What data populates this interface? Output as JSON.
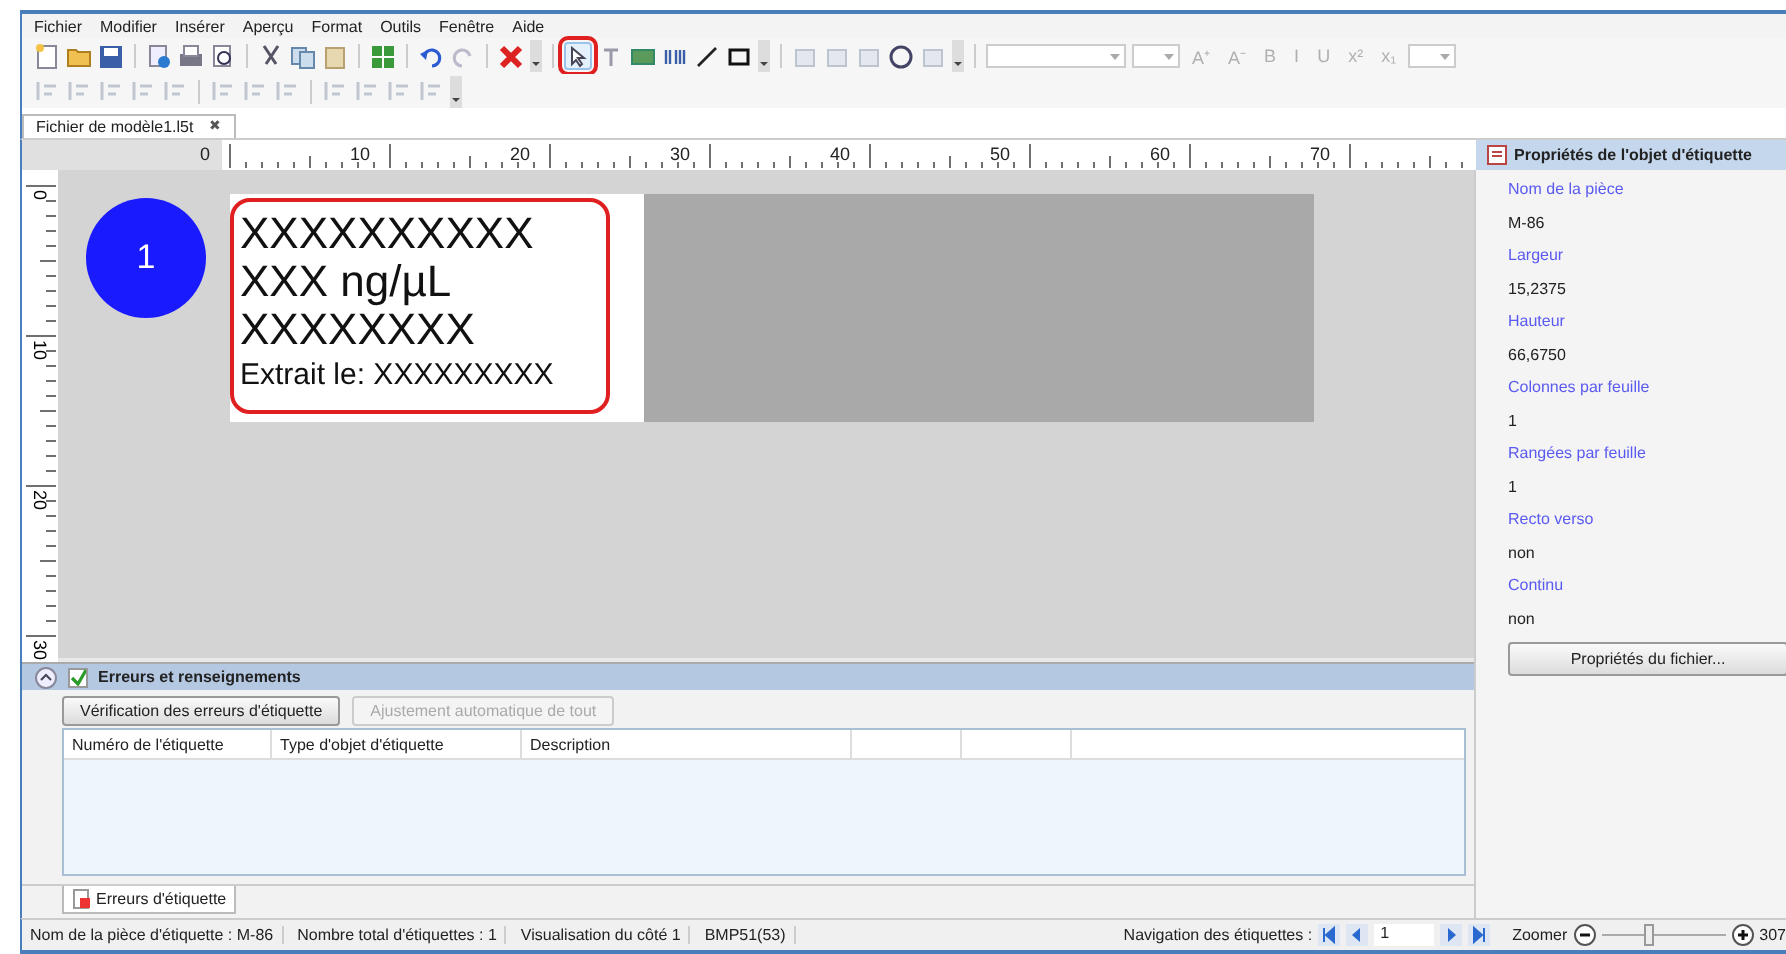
{
  "menu": [
    "Fichier",
    "Modifier",
    "Insérer",
    "Aperçu",
    "Format",
    "Outils",
    "Fenêtre",
    "Aide"
  ],
  "toolbar": {
    "pointer_highlighted": true,
    "format_buttons": [
      "A⁺",
      "A⁻",
      "B",
      "I",
      "U",
      "x²",
      "x₁"
    ]
  },
  "document_tab": {
    "label": "Fichier de modèle1.l5t",
    "close": "✖"
  },
  "ruler": {
    "horizontal": [
      "0",
      "10",
      "20",
      "30",
      "40",
      "50",
      "60",
      "70"
    ],
    "vertical": [
      "0",
      "10",
      "20",
      "30"
    ]
  },
  "label": {
    "number": "1",
    "highlighted": true,
    "lines": [
      {
        "text": "XXXXXXXXXX",
        "kind": "large"
      },
      {
        "text": "XXX ng/µL",
        "kind": "large"
      },
      {
        "text": "XXXXXXXX",
        "kind": "large"
      },
      {
        "text": "Extrait le: XXXXXXXXX",
        "kind": "small"
      }
    ]
  },
  "errors_panel": {
    "title": "Erreurs et renseignements",
    "checked": true,
    "buttons": [
      {
        "label": "Vérification des erreurs d'étiquette",
        "disabled": false
      },
      {
        "label": "Ajustement automatique de tout",
        "disabled": true
      }
    ],
    "columns": [
      "Numéro de l'étiquette",
      "Type d'objet d'étiquette",
      "Description"
    ],
    "tab": "Erreurs d'étiquette"
  },
  "properties": {
    "title": "Propriétés de l'objet d'étiquette",
    "fields": [
      {
        "label": "Nom de la pièce",
        "value": "M-86"
      },
      {
        "label": "Largeur",
        "value": "15,2375"
      },
      {
        "label": "Hauteur",
        "value": "66,6750"
      },
      {
        "label": "Colonnes par feuille",
        "value": "1"
      },
      {
        "label": "Rangées par feuille",
        "value": "1"
      },
      {
        "label": "Recto verso",
        "value": "non"
      },
      {
        "label": "Continu",
        "value": "non"
      }
    ],
    "button": "Propriétés du fichier..."
  },
  "status_bar": {
    "items": [
      "Nom de la pièce d'étiquette : M-86",
      "Nombre total d'étiquettes : 1",
      "Visualisation du côté 1",
      "BMP51(53)"
    ],
    "navigation_label": "Navigation des étiquettes :",
    "page": "1",
    "zoom_label": "Zoomer",
    "zoom": {
      "level": 0.38,
      "value": "307"
    }
  }
}
